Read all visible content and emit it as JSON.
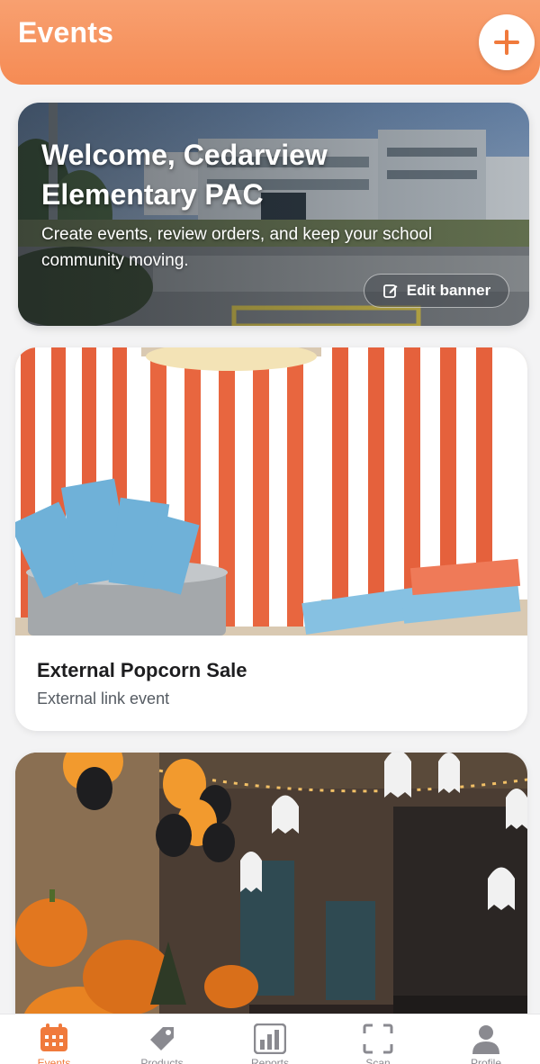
{
  "header": {
    "title": "Events",
    "add_icon": "plus-icon",
    "accent_color": "#f58b54"
  },
  "banner": {
    "title": "Welcome, Cedarview Elementary PAC",
    "subtitle": "Create events, review orders, and keep your school community moving.",
    "edit_label": "Edit banner",
    "edit_icon": "edit-icon"
  },
  "events": [
    {
      "title": "External Popcorn Sale",
      "subtitle": "External link event",
      "image": "popcorn-tickets-photo"
    },
    {
      "title": "",
      "subtitle": "",
      "image": "halloween-party-photo"
    }
  ],
  "bottom_nav": {
    "items": [
      {
        "label": "Events",
        "icon": "calendar-icon",
        "active": true
      },
      {
        "label": "Products",
        "icon": "tag-icon",
        "active": false
      },
      {
        "label": "Reports",
        "icon": "bar-chart-icon",
        "active": false
      },
      {
        "label": "Scan",
        "icon": "scan-icon",
        "active": false
      },
      {
        "label": "Profile",
        "icon": "person-icon",
        "active": false
      }
    ]
  }
}
